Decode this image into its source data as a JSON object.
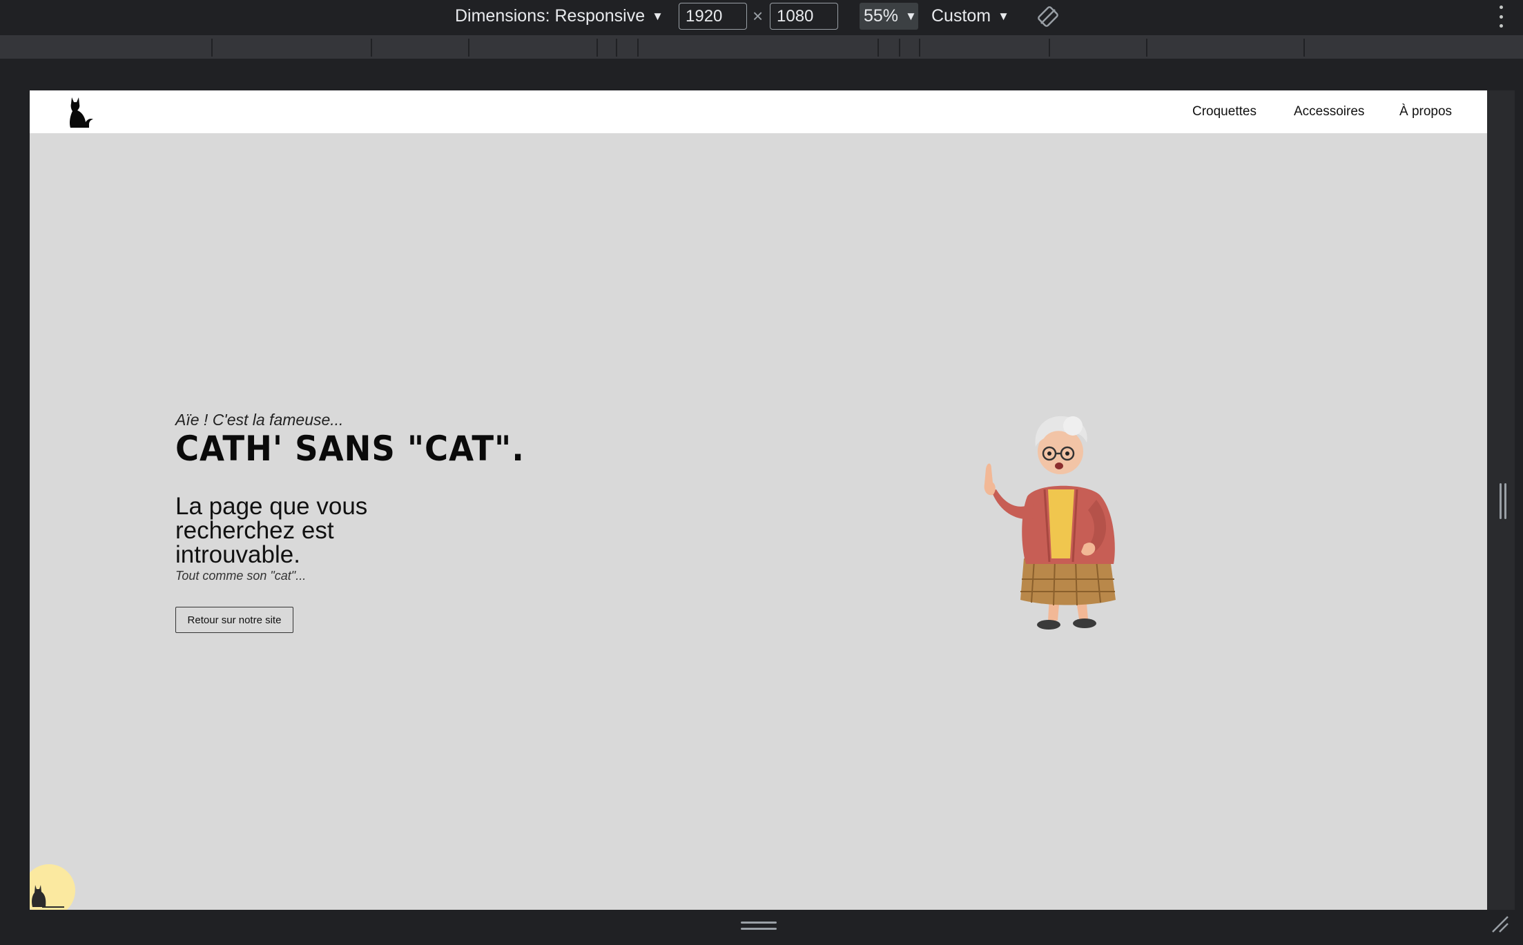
{
  "devtools": {
    "dimensions_label": "Dimensions: Responsive",
    "width_value": "1920",
    "times": "×",
    "height_value": "1080",
    "zoom": "55%",
    "throttle": "Custom",
    "icons": [
      "caret-down-icon",
      "rotate-icon",
      "more-options-icon",
      "resize-grip-icon"
    ]
  },
  "site": {
    "nav": {
      "items": [
        {
          "label": "Croquettes"
        },
        {
          "label": "Accessoires"
        },
        {
          "label": "À propos"
        }
      ]
    },
    "hero": {
      "tagline": "Aïe ! C'est la fameuse...",
      "headline": "CATH' SANS \"CAT\".",
      "subtitle": "La page que vous recherchez est introuvable.",
      "note": "Tout comme son \"cat\"...",
      "button_label": "Retour sur notre site"
    },
    "colors": {
      "page_background": "#d9d9d9",
      "header_background": "#ffffff",
      "badge_background": "#fbe9a0"
    }
  }
}
